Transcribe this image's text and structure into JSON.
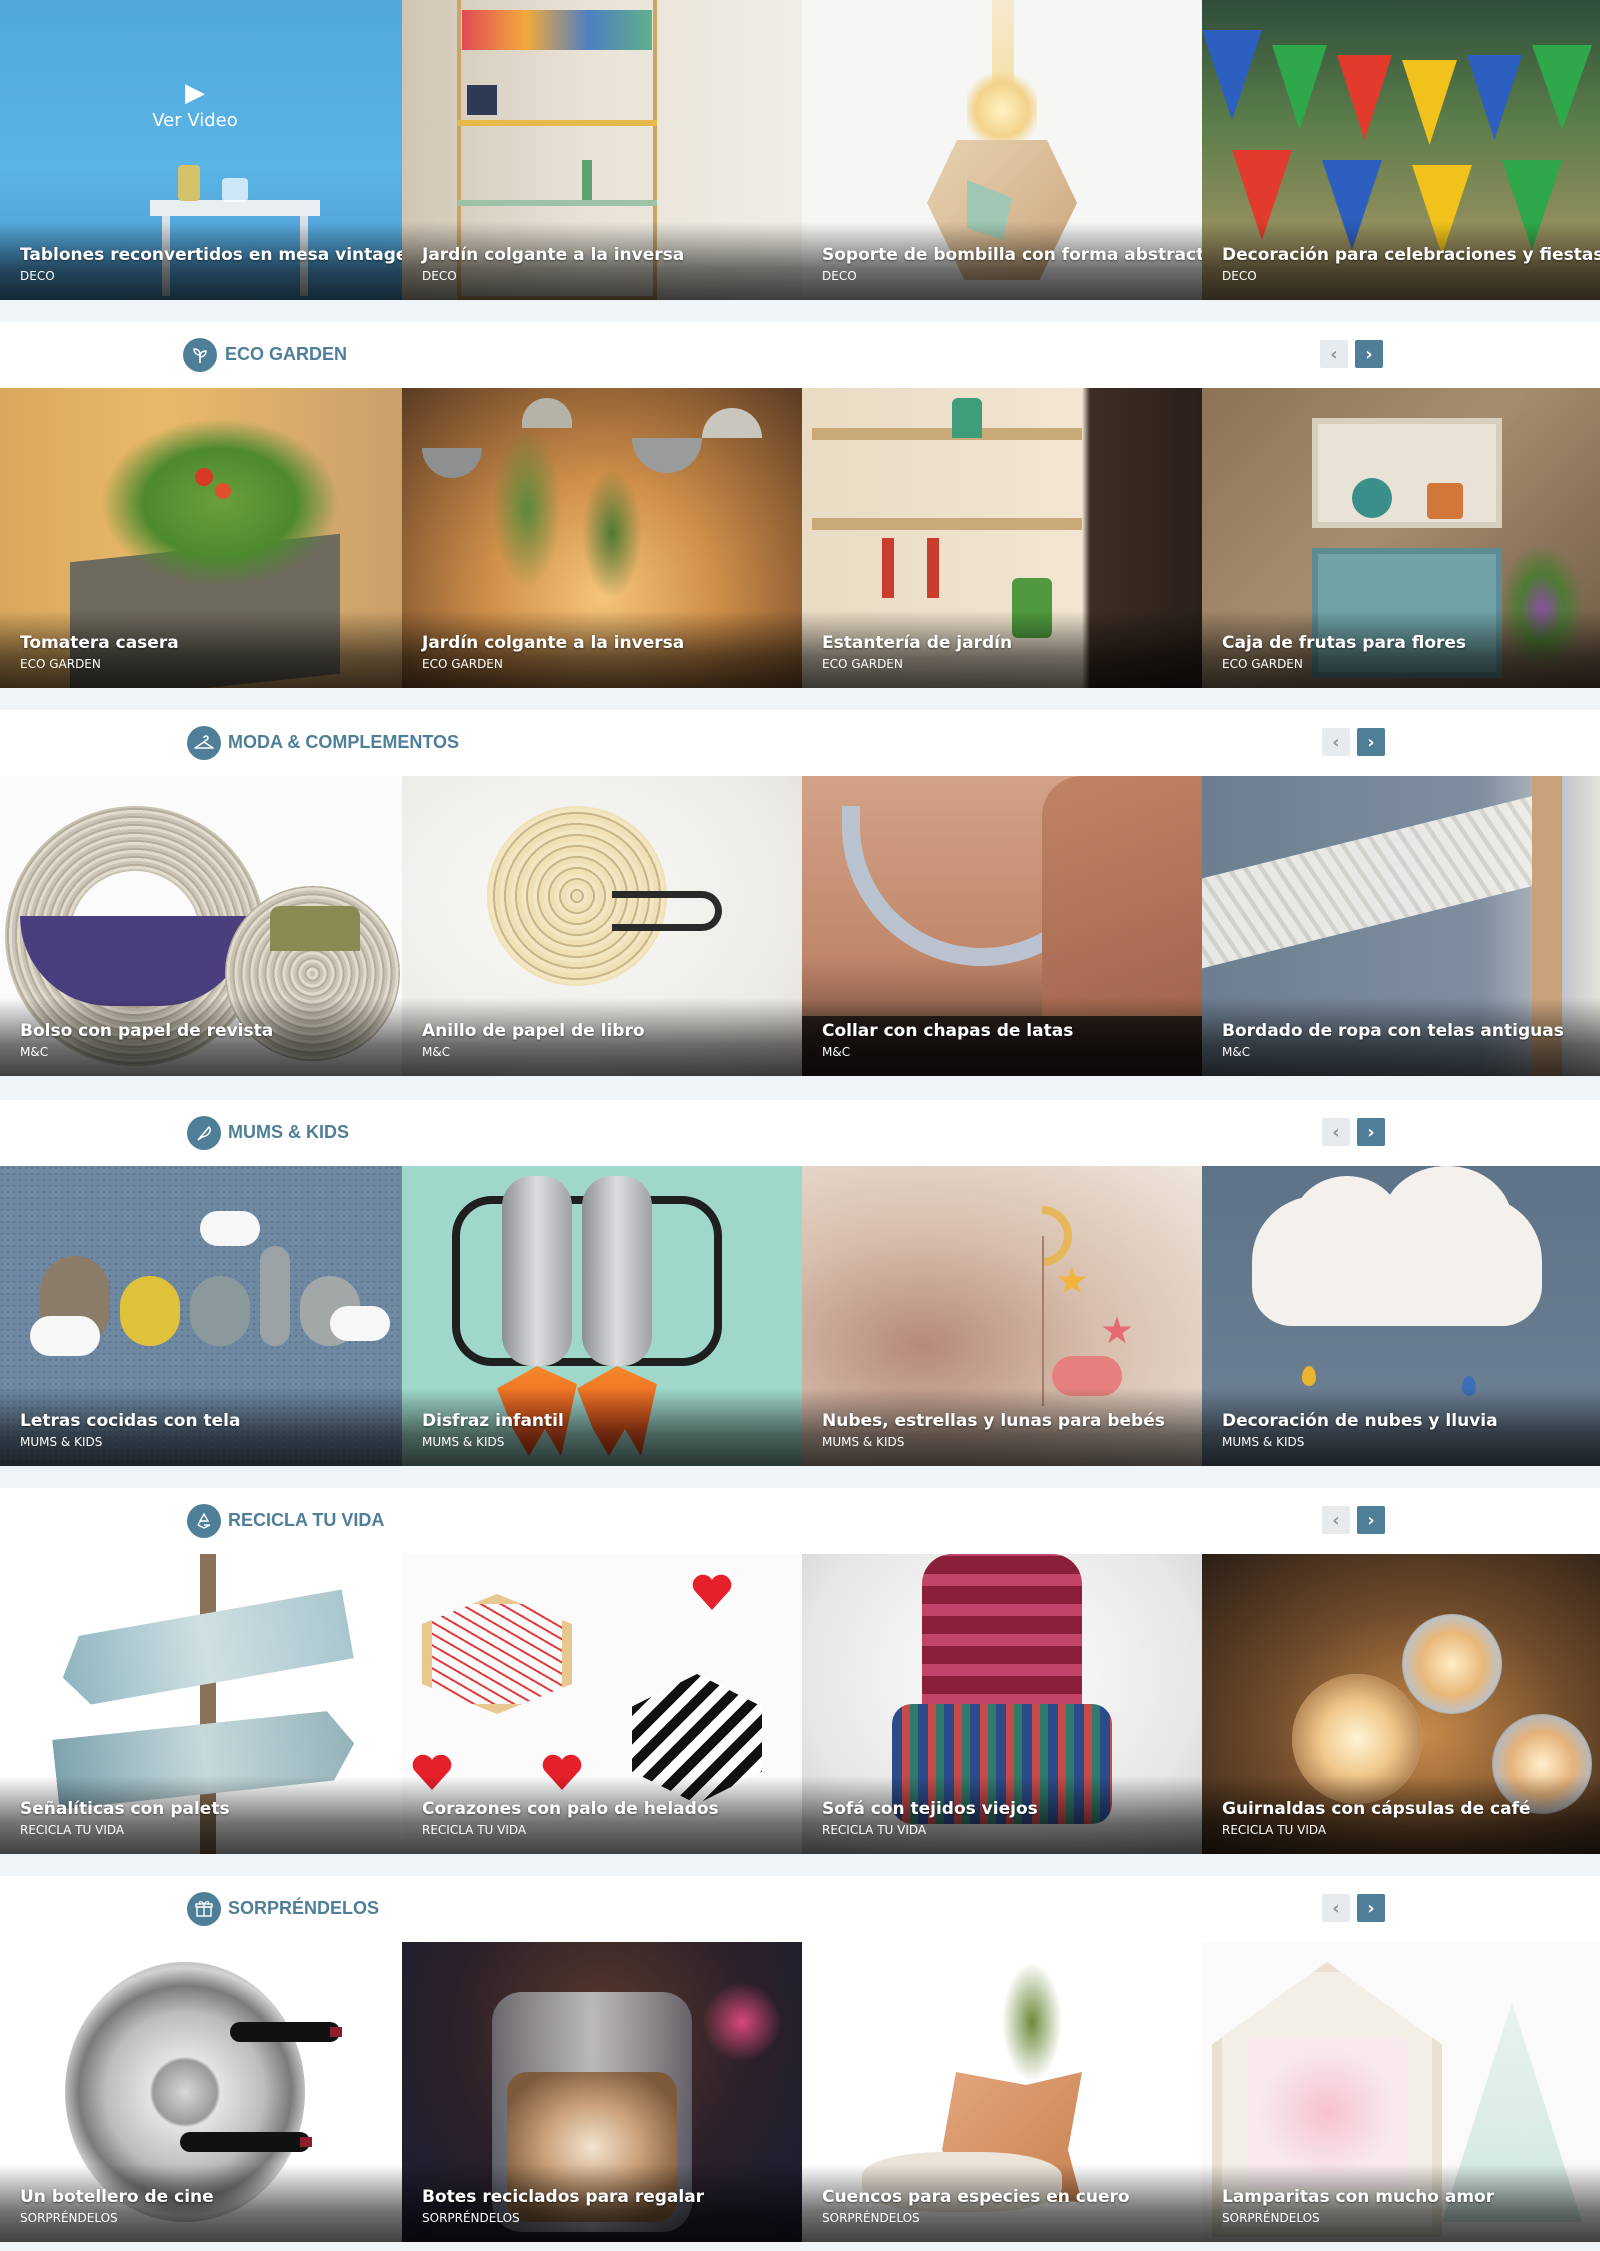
{
  "video_label": "Ver Video",
  "top_row": [
    {
      "title": "Tablones reconvertidos en mesa vintage",
      "category": "DECO"
    },
    {
      "title": "Jardín colgante a la inversa",
      "category": "DECO"
    },
    {
      "title": "Soporte de bombilla con forma abstracta",
      "category": "DECO"
    },
    {
      "title": "Decoración para celebraciones y fiestas",
      "category": "DECO"
    }
  ],
  "sections": [
    {
      "label": "ECO GARDEN",
      "icon": "sprout-icon",
      "items": [
        {
          "title": "Tomatera casera",
          "category": "ECO GARDEN"
        },
        {
          "title": "Jardín colgante a la inversa",
          "category": "ECO GARDEN"
        },
        {
          "title": "Estantería de jardín",
          "category": "ECO GARDEN"
        },
        {
          "title": "Caja de frutas para flores",
          "category": "ECO GARDEN"
        }
      ]
    },
    {
      "label": "MODA & COMPLEMENTOS",
      "icon": "hanger-icon",
      "items": [
        {
          "title": "Bolso con papel de revista",
          "category": "M&C"
        },
        {
          "title": "Anillo de papel de libro",
          "category": "M&C"
        },
        {
          "title": "Collar con chapas de latas",
          "category": "M&C"
        },
        {
          "title": "Bordado de ropa con telas antiguas",
          "category": "M&C"
        }
      ]
    },
    {
      "label": "MUMS & KIDS",
      "icon": "feather-icon",
      "items": [
        {
          "title": "Letras cocidas con tela",
          "category": "MUMS & KIDS"
        },
        {
          "title": "Disfraz infantil",
          "category": "MUMS & KIDS"
        },
        {
          "title": "Nubes, estrellas y lunas para bebés",
          "category": "MUMS & KIDS"
        },
        {
          "title": "Decoración de nubes y lluvia",
          "category": "MUMS & KIDS"
        }
      ]
    },
    {
      "label": "RECICLA TU VIDA",
      "icon": "recycle-icon",
      "items": [
        {
          "title": "Señalíticas con palets",
          "category": "RECICLA TU VIDA"
        },
        {
          "title": "Corazones con palo de helados",
          "category": "RECICLA TU VIDA"
        },
        {
          "title": "Sofá con tejidos viejos",
          "category": "RECICLA TU VIDA"
        },
        {
          "title": "Guirnaldas con cápsulas de café",
          "category": "RECICLA TU VIDA"
        }
      ]
    },
    {
      "label": "SORPRÉNDELOS",
      "icon": "gift-icon",
      "items": [
        {
          "title": "Un botellero de cine",
          "category": "SORPRÉNDELOS"
        },
        {
          "title": "Botes reciclados para regalar",
          "category": "SORPRÉNDELOS"
        },
        {
          "title": "Cuencos para especies en cuero",
          "category": "SORPRÉNDELOS"
        },
        {
          "title": "Lamparitas con mucho amor",
          "category": "SORPRÉNDELOS"
        }
      ]
    }
  ],
  "nav": {
    "prev": "‹",
    "next": "›"
  }
}
